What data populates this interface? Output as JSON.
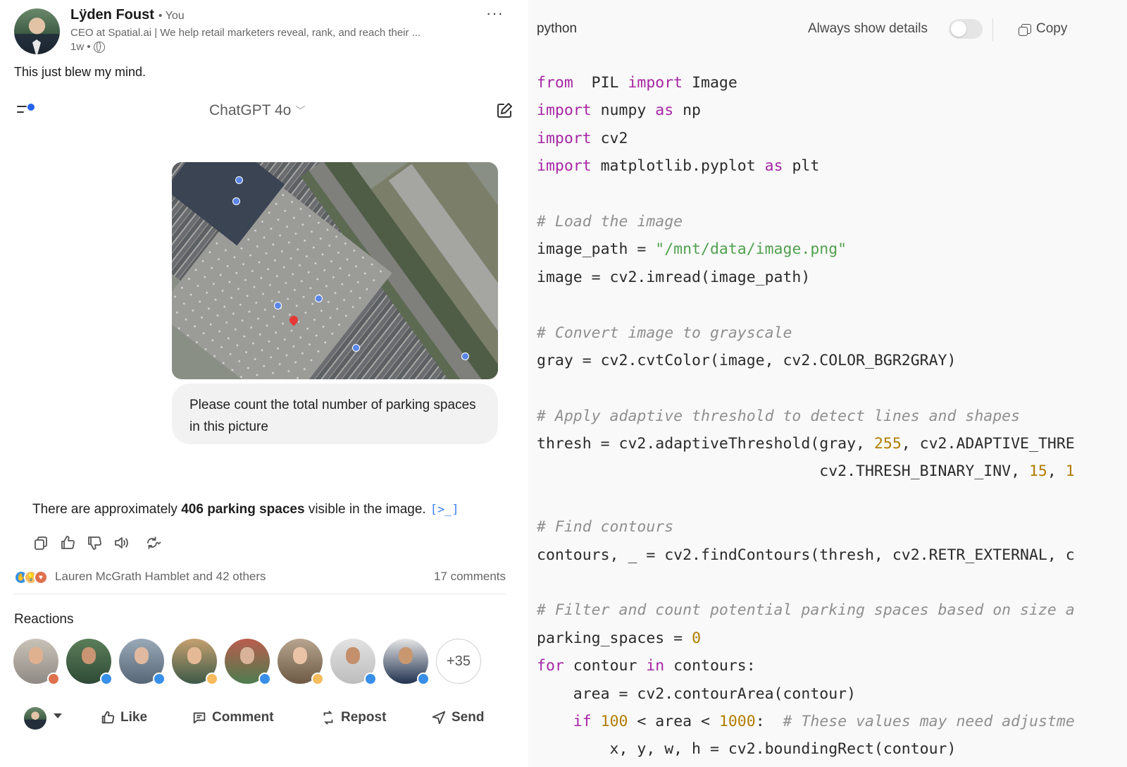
{
  "post": {
    "author": "Lÿden Foust",
    "you": "• You",
    "headline": "CEO at Spatial.ai | We help retail marketers reveal, rank, and reach their ...",
    "time": "1w •",
    "text": "This just blew my mind.",
    "more_icon": "ellipsis-icon"
  },
  "chat": {
    "model": "ChatGPT 4o",
    "prompt": "Please count the total number of parking spaces in this picture",
    "answer_pre": "There are approximately ",
    "answer_bold": "406 parking spaces",
    "answer_post": " visible in the image.",
    "code_link": "[>_]"
  },
  "social": {
    "reactors": "Lauren McGrath Hamblet and 42 others",
    "comments": "17 comments",
    "reactions_title": "Reactions",
    "more_count": "+35"
  },
  "actions": {
    "like": "Like",
    "comment": "Comment",
    "repost": "Repost",
    "send": "Send"
  },
  "code_panel": {
    "language": "python",
    "details_label": "Always show details",
    "copy_label": "Copy",
    "details_enabled": false,
    "lines": [
      [
        [
          "kw",
          "from"
        ],
        [
          "",
          "  PIL "
        ],
        [
          "kw",
          "import"
        ],
        [
          "",
          " Image"
        ]
      ],
      [
        [
          "kw",
          "import"
        ],
        [
          "",
          " numpy "
        ],
        [
          "kw",
          "as"
        ],
        [
          "",
          " np"
        ]
      ],
      [
        [
          "kw",
          "import"
        ],
        [
          "",
          " cv2"
        ]
      ],
      [
        [
          "kw",
          "import"
        ],
        [
          "",
          " matplotlib.pyplot "
        ],
        [
          "kw",
          "as"
        ],
        [
          "",
          " plt"
        ]
      ],
      [],
      [
        [
          "cm",
          "# Load the image"
        ]
      ],
      [
        [
          "",
          "image_path = "
        ],
        [
          "st",
          "\"/mnt/data/image.png\""
        ]
      ],
      [
        [
          "",
          "image = cv2.imread(image_path)"
        ]
      ],
      [],
      [
        [
          "cm",
          "# Convert image to grayscale"
        ]
      ],
      [
        [
          "",
          "gray = cv2.cvtColor(image, cv2.COLOR_BGR2GRAY)"
        ]
      ],
      [],
      [
        [
          "cm",
          "# Apply adaptive threshold to detect lines and shapes"
        ]
      ],
      [
        [
          "",
          "thresh = cv2.adaptiveThreshold(gray, "
        ],
        [
          "nm",
          "255"
        ],
        [
          "",
          ", cv2.ADAPTIVE_THRE"
        ]
      ],
      [
        [
          "",
          "                               cv2.THRESH_BINARY_INV, "
        ],
        [
          "nm",
          "15"
        ],
        [
          "",
          ", "
        ],
        [
          "nm",
          "1"
        ]
      ],
      [],
      [
        [
          "cm",
          "# Find contours"
        ]
      ],
      [
        [
          "",
          "contours, _ = cv2.findContours(thresh, cv2.RETR_EXTERNAL, c"
        ]
      ],
      [],
      [
        [
          "cm",
          "# Filter and count potential parking spaces based on size a"
        ]
      ],
      [
        [
          "",
          "parking_spaces = "
        ],
        [
          "nm",
          "0"
        ]
      ],
      [
        [
          "kw",
          "for"
        ],
        [
          "",
          " contour "
        ],
        [
          "kw",
          "in"
        ],
        [
          "",
          " contours:"
        ]
      ],
      [
        [
          "",
          "    area = cv2.contourArea(contour)"
        ]
      ],
      [
        [
          "",
          "    "
        ],
        [
          "kw",
          "if"
        ],
        [
          "",
          " "
        ],
        [
          "nm",
          "100"
        ],
        [
          "",
          " < area < "
        ],
        [
          "nm",
          "1000"
        ],
        [
          "",
          ":  "
        ],
        [
          "cm",
          "# These values may need adjustme"
        ]
      ],
      [
        [
          "",
          "        x, y, w, h = cv2.boundingRect(contour)"
        ]
      ]
    ]
  }
}
